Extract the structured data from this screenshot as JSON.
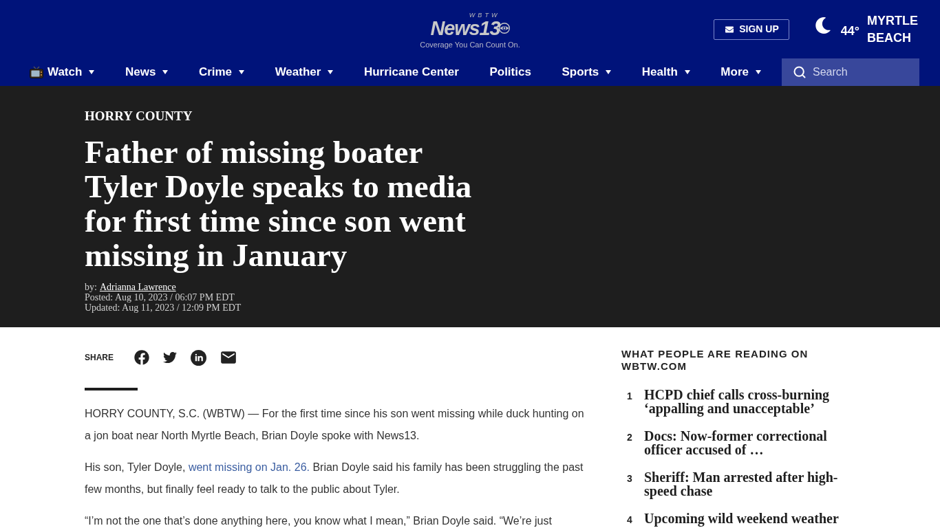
{
  "header": {
    "logo": {
      "callsign": "WBTW",
      "wordmark": "News13",
      "tagline": "Coverage You Can Count On."
    },
    "signup": {
      "label": "SIGN UP"
    },
    "weather": {
      "temperature": "44°",
      "location": "MYRTLE BEACH"
    }
  },
  "nav": {
    "items": [
      {
        "label": "Watch",
        "has_icon": true,
        "has_menu": true
      },
      {
        "label": "News",
        "has_icon": false,
        "has_menu": true
      },
      {
        "label": "Crime",
        "has_icon": false,
        "has_menu": true
      },
      {
        "label": "Weather",
        "has_icon": false,
        "has_menu": true
      },
      {
        "label": "Hurricane Center",
        "has_icon": false,
        "has_menu": false
      },
      {
        "label": "Politics",
        "has_icon": false,
        "has_menu": false
      },
      {
        "label": "Sports",
        "has_icon": false,
        "has_menu": true
      },
      {
        "label": "Health",
        "has_icon": false,
        "has_menu": true
      },
      {
        "label": "More",
        "has_icon": false,
        "has_menu": true
      }
    ],
    "search": {
      "placeholder": "Search"
    }
  },
  "article": {
    "category": "HORRY COUNTY",
    "headline": "Father of missing boater Tyler Doyle speaks to media for first time since son went missing in January",
    "byline": {
      "prefix": "by:",
      "author": "Adrianna Lawrence",
      "posted": "Posted: Aug 10, 2023 / 06:07 PM EDT",
      "updated": "Updated: Aug 11, 2023 / 12:09 PM EDT"
    },
    "share": {
      "label": "SHARE"
    },
    "paragraphs": [
      [
        {
          "text": "HORRY COUNTY, S.C. (WBTW) — For the first time since his son went missing while duck hunting on a jon boat near North Myrtle Beach, Brian Doyle spoke with News13.",
          "link": false
        }
      ],
      [
        {
          "text": "His son, Tyler Doyle, ",
          "link": false
        },
        {
          "text": "went missing on Jan. 26.",
          "link": true
        },
        {
          "text": " Brian Doyle said his family has been struggling the past few months, but finally feel ready to talk to the public about Tyler.",
          "link": false
        }
      ],
      [
        {
          "text": "“I’m not the one that’s done anything here, you know what I mean,” Brian Doyle said. “We’re just",
          "link": false
        }
      ]
    ]
  },
  "sidebar": {
    "heading": "WHAT PEOPLE ARE READING ON WBTW.COM",
    "items": [
      {
        "rank": "1",
        "title": "HCPD chief calls cross-burning ‘appalling and unacceptable’"
      },
      {
        "rank": "2",
        "title": "Docs: Now-former correctional officer accused of …"
      },
      {
        "rank": "3",
        "title": "Sheriff: Man arrested after high-speed chase"
      },
      {
        "rank": "4",
        "title": "Upcoming wild weekend weather"
      }
    ]
  }
}
